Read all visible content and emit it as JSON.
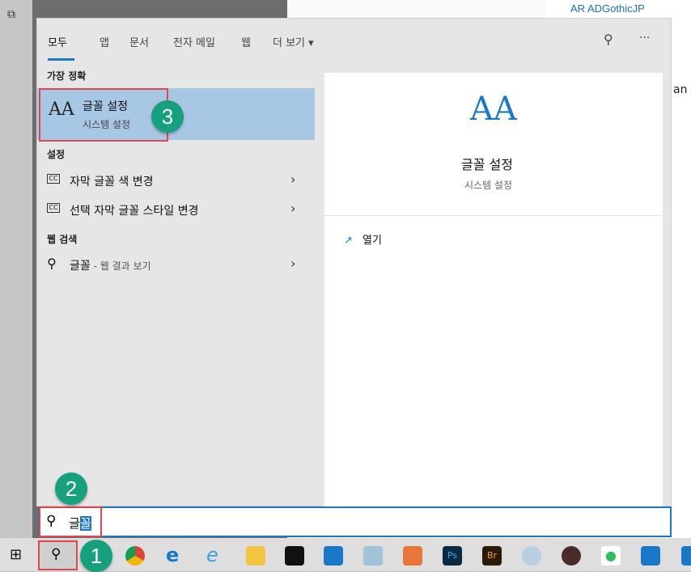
{
  "background": {
    "font_list_item": "AR ADGothicJP",
    "partial_text": "an"
  },
  "tabs": [
    {
      "label": "모두"
    },
    {
      "label": "앱"
    },
    {
      "label": "문서"
    },
    {
      "label": "전자 메일"
    },
    {
      "label": "웹"
    },
    {
      "label": "더 보기 ▾"
    }
  ],
  "header_icons": {
    "feedback": "feedback-icon",
    "more": "···"
  },
  "sections": {
    "best": "가장 정확",
    "settings": "설정",
    "web": "웹 검색"
  },
  "best_match": {
    "title": "글꼴 설정",
    "subtitle": "시스템 설정",
    "icon": "AA"
  },
  "settings_items": [
    {
      "label": "자막 글꼴 색 변경"
    },
    {
      "label": "선택 자막 글꼴 스타일 변경"
    }
  ],
  "web_item": {
    "label": "글꼴",
    "suffix": " - 웹 결과 보기"
  },
  "preview": {
    "title": "글꼴 설정",
    "subtitle": "시스템 설정",
    "open_label": "열기"
  },
  "search": {
    "typed": "글",
    "selected": "꼴"
  },
  "badges": [
    "1",
    "2",
    "3"
  ],
  "colors": {
    "accent": "#1a78c9",
    "highlight": "#a8c7e4",
    "badge": "#17a07d",
    "callout": "#e0474c"
  }
}
